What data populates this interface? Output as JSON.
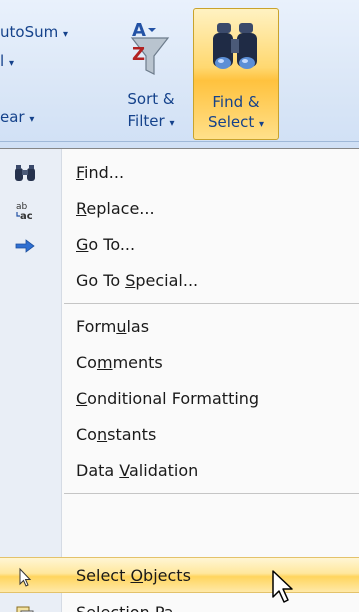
{
  "ribbon": {
    "autosum_label": "utoSum",
    "fill_label": "l",
    "clear_label": "ear",
    "dropdown_glyph": "▾",
    "sort_filter": {
      "line1": "Sort &",
      "line2": "Filter",
      "arrow": "▾",
      "icon": "sort-az-funnel-icon"
    },
    "find_select": {
      "line1": "Find &",
      "line2": "Select",
      "arrow": "▾",
      "icon": "binoculars-icon",
      "state": "pressed"
    }
  },
  "menu": {
    "items": [
      {
        "label": "Find...",
        "icon": "binoculars-icon",
        "access_key": "F"
      },
      {
        "label": "Replace...",
        "icon": "replace-icon",
        "access_key": "R"
      },
      {
        "label": "Go To...",
        "icon": "arrow-right-icon",
        "access_key": "G"
      },
      {
        "label": "Go To Special...",
        "icon": "",
        "access_key": "S"
      },
      {
        "label": "Formulas",
        "icon": "",
        "access_key": "U"
      },
      {
        "label": "Comments",
        "icon": "",
        "access_key": "M"
      },
      {
        "label": "Conditional Formatting",
        "icon": "",
        "access_key": "C"
      },
      {
        "label": "Constants",
        "icon": "",
        "access_key": "N"
      },
      {
        "label": "Data Validation",
        "icon": "",
        "access_key": "V"
      },
      {
        "label": "Select Objects",
        "icon": "pointer-arrow-icon",
        "access_key": "O",
        "highlighted": true
      },
      {
        "label": "Selection Pa",
        "icon": "selection-pane-icon",
        "access_key": ""
      }
    ]
  },
  "colors": {
    "ribbon_text": "#15428b",
    "highlight": "#ffd55e",
    "menu_bg": "#fafafa",
    "gutter_bg": "#e9eef6"
  }
}
